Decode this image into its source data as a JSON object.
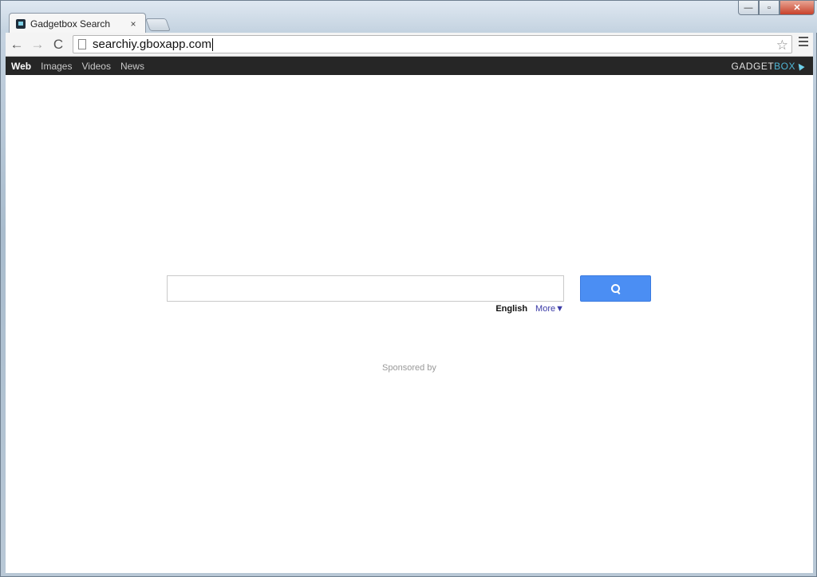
{
  "browser": {
    "tab_title": "Gadgetbox Search",
    "tab_close": "×",
    "url": "searchiy.gboxapp.com",
    "star": "☆",
    "back": "←",
    "forward": "→",
    "reload": "C"
  },
  "window": {
    "minimize": "—",
    "maximize": "▫",
    "close": "✕"
  },
  "topnav": {
    "items": [
      "Web",
      "Images",
      "Videos",
      "News"
    ],
    "active": "Web"
  },
  "brand": {
    "part1": "GADGET",
    "part2": "BOX"
  },
  "search": {
    "query": "",
    "language": "English",
    "more": "More▼"
  },
  "footer": {
    "sponsored": "Sponsored by"
  },
  "colors": {
    "search_button": "#4b8ef3",
    "topbar": "#262626",
    "brand_accent": "#4fb6d6"
  }
}
